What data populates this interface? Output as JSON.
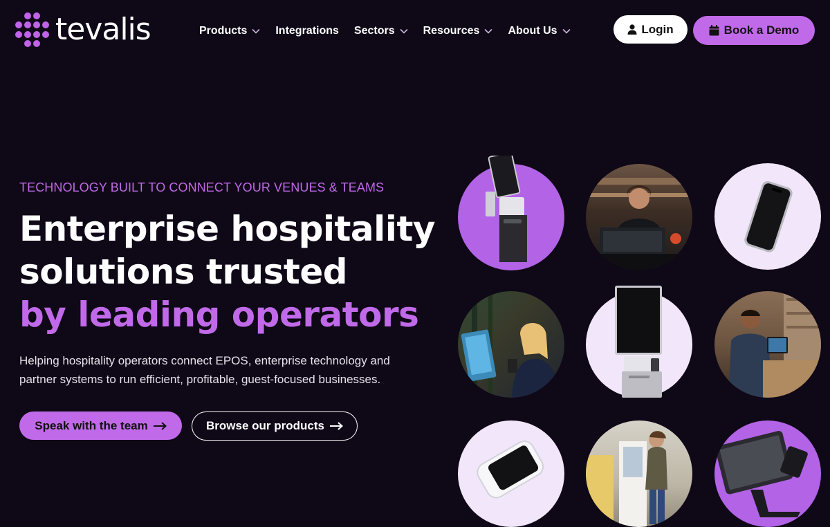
{
  "brand": {
    "name": "tevalis"
  },
  "nav": {
    "items": [
      {
        "label": "Products",
        "has_dropdown": true
      },
      {
        "label": "Integrations",
        "has_dropdown": false
      },
      {
        "label": "Sectors",
        "has_dropdown": true
      },
      {
        "label": "Resources",
        "has_dropdown": true
      },
      {
        "label": "About Us",
        "has_dropdown": true
      }
    ],
    "login_label": "Login",
    "demo_label": "Book a Demo"
  },
  "hero": {
    "eyebrow": "TECHNOLOGY BUILT TO CONNECT YOUR VENUES & TEAMS",
    "headline_line1": "Enterprise hospitality",
    "headline_line2": "solutions trusted",
    "headline_accent": "by leading operators",
    "subtext": "Helping hospitality operators connect EPOS, enterprise technology and partner systems to run efficient, profitable, guest-focused businesses.",
    "primary_cta": "Speak with the team",
    "secondary_cta": "Browse our products"
  },
  "gallery": {
    "items": [
      {
        "icon": "kiosk-terminal-icon",
        "style": "purple"
      },
      {
        "icon": "staff-at-till-photo",
        "style": "photo"
      },
      {
        "icon": "smartphone-icon",
        "style": "light"
      },
      {
        "icon": "staff-with-phone-photo",
        "style": "photo"
      },
      {
        "icon": "self-service-kiosk-icon",
        "style": "light"
      },
      {
        "icon": "staff-at-epos-photo",
        "style": "photo"
      },
      {
        "icon": "card-payment-terminal-icon",
        "style": "light"
      },
      {
        "icon": "customer-at-kiosk-photo",
        "style": "photo"
      },
      {
        "icon": "pos-terminal-icon",
        "style": "purple"
      }
    ]
  },
  "colors": {
    "background": "#0f0817",
    "accent": "#c16ae9",
    "light_circle": "#f2e6fb",
    "text": "#ffffff"
  }
}
